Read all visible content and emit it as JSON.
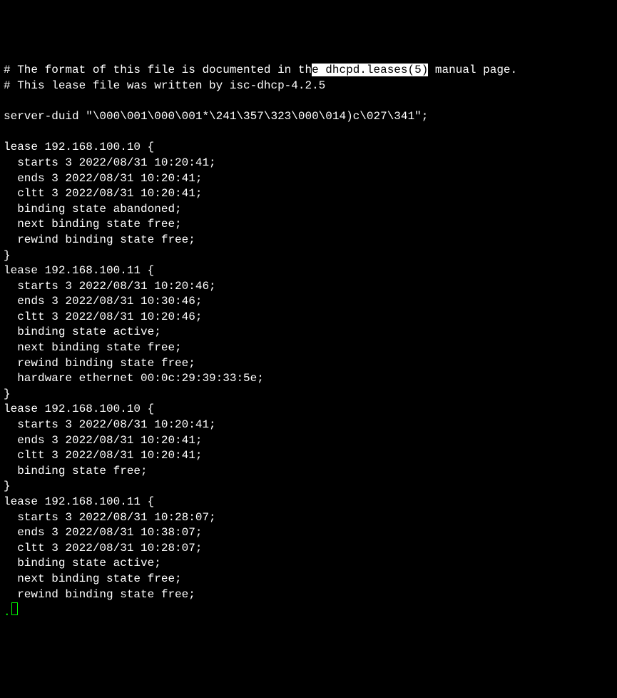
{
  "terminal": {
    "comment1_prefix": "# The format of this file is documented in th",
    "comment1_selected": "e dhcpd.leases(5)",
    "comment1_suffix": " manual page.",
    "comment2": "# This lease file was written by isc-dhcp-4.2.5",
    "blank1": "",
    "server_duid": "server-duid \"\\000\\001\\000\\001*\\241\\357\\323\\000\\014)c\\027\\341\";",
    "blank2": "",
    "lease1_header": "lease 192.168.100.10 {",
    "lease1_starts": "  starts 3 2022/08/31 10:20:41;",
    "lease1_ends": "  ends 3 2022/08/31 10:20:41;",
    "lease1_cltt": "  cltt 3 2022/08/31 10:20:41;",
    "lease1_binding": "  binding state abandoned;",
    "lease1_next": "  next binding state free;",
    "lease1_rewind": "  rewind binding state free;",
    "lease1_close": "}",
    "lease2_header": "lease 192.168.100.11 {",
    "lease2_starts": "  starts 3 2022/08/31 10:20:46;",
    "lease2_ends": "  ends 3 2022/08/31 10:30:46;",
    "lease2_cltt": "  cltt 3 2022/08/31 10:20:46;",
    "lease2_binding": "  binding state active;",
    "lease2_next": "  next binding state free;",
    "lease2_rewind": "  rewind binding state free;",
    "lease2_hardware": "  hardware ethernet 00:0c:29:39:33:5e;",
    "lease2_close": "}",
    "lease3_header": "lease 192.168.100.10 {",
    "lease3_starts": "  starts 3 2022/08/31 10:20:41;",
    "lease3_ends": "  ends 3 2022/08/31 10:20:41;",
    "lease3_cltt": "  cltt 3 2022/08/31 10:20:41;",
    "lease3_binding": "  binding state free;",
    "lease3_close": "}",
    "lease4_header": "lease 192.168.100.11 {",
    "lease4_starts": "  starts 3 2022/08/31 10:28:07;",
    "lease4_ends": "  ends 3 2022/08/31 10:38:07;",
    "lease4_cltt": "  cltt 3 2022/08/31 10:28:07;",
    "lease4_binding": "  binding state active;",
    "lease4_next": "  next binding state free;",
    "lease4_rewind": "  rewind binding state free;",
    "cursor_dot": "."
  }
}
